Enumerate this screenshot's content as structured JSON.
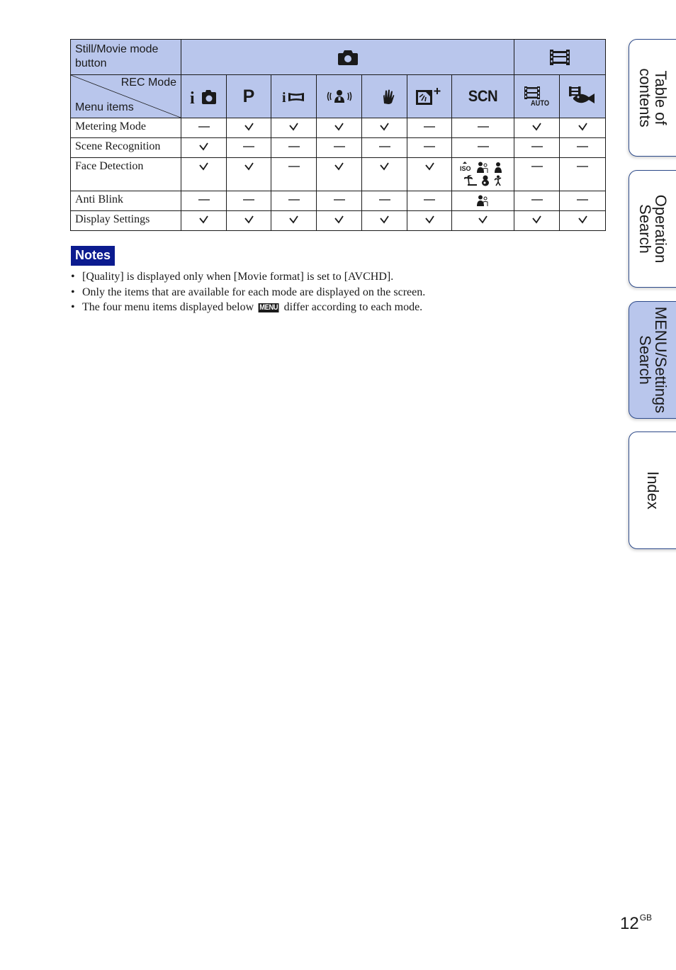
{
  "table": {
    "header": {
      "mode_button_label": "Still/Movie mode button",
      "rec_mode_label": "REC Mode",
      "menu_items_label": "Menu items",
      "groups": [
        {
          "name": "still",
          "icon": "camera-icon"
        },
        {
          "name": "movie",
          "icon": "movie-film-icon"
        }
      ],
      "modes": [
        {
          "id": "intelligent-auto",
          "icon": "intelligent-auto-icon"
        },
        {
          "id": "program-auto",
          "icon": "program-p-icon",
          "text": "P"
        },
        {
          "id": "intelligent-sweep-panorama",
          "icon": "intelligent-panorama-icon"
        },
        {
          "id": "anti-motion-blur",
          "icon": "anti-motion-blur-icon"
        },
        {
          "id": "hand-held-twilight",
          "icon": "handheld-twilight-icon"
        },
        {
          "id": "backlight-correction-hdr",
          "icon": "backlight-hdr-icon"
        },
        {
          "id": "scene-selection",
          "icon": "scn-icon",
          "text": "SCN"
        },
        {
          "id": "movie-auto",
          "icon": "movie-auto-icon",
          "text": "AUTO"
        },
        {
          "id": "underwater-movie",
          "icon": "underwater-movie-icon"
        }
      ]
    },
    "rows": [
      {
        "name": "Metering Mode",
        "values": [
          "dash",
          "check",
          "check",
          "check",
          "check",
          "dash",
          "dash",
          "check",
          "check"
        ]
      },
      {
        "name": "Scene Recognition",
        "values": [
          "check",
          "dash",
          "dash",
          "dash",
          "dash",
          "dash",
          "dash",
          "dash",
          "dash"
        ]
      },
      {
        "name": "Face Detection",
        "values": [
          "check",
          "check",
          "dash",
          "check",
          "check",
          "check",
          "scene-icons",
          "dash",
          "dash"
        ],
        "scene_icons": [
          "high-sensitivity-iso-icon",
          "soft-snap-icon",
          "night-portrait-icon",
          "beach-icon",
          "baby-snow-icon",
          "gourmet-pet-icon"
        ]
      },
      {
        "name": "Anti Blink",
        "values": [
          "dash",
          "dash",
          "dash",
          "dash",
          "dash",
          "dash",
          "soft-snap",
          "dash",
          "dash"
        ]
      },
      {
        "name": "Display Settings",
        "values": [
          "check",
          "check",
          "check",
          "check",
          "check",
          "check",
          "check",
          "check",
          "check"
        ]
      }
    ]
  },
  "notes": {
    "title": "Notes",
    "items": [
      "[Quality] is displayed only when [Movie format] is set to [AVCHD].",
      "Only the items that are available for each mode are displayed on the screen.",
      {
        "before": "The four menu items displayed below ",
        "glyph": "MENU",
        "after": " differ according to each mode."
      }
    ]
  },
  "side_tabs": [
    {
      "lines": [
        "Table of",
        "contents"
      ],
      "active": false
    },
    {
      "lines": [
        "Operation",
        "Search"
      ],
      "active": false
    },
    {
      "lines": [
        "MENU/Settings",
        "Search"
      ],
      "active": true
    },
    {
      "lines": [
        "Index"
      ],
      "active": false
    }
  ],
  "page": {
    "number": "12",
    "suffix": "GB"
  },
  "colors": {
    "header_bg": "#b9c6ec",
    "notes_bg": "#0b1b8f",
    "tab_border": "#2d4a8a"
  }
}
